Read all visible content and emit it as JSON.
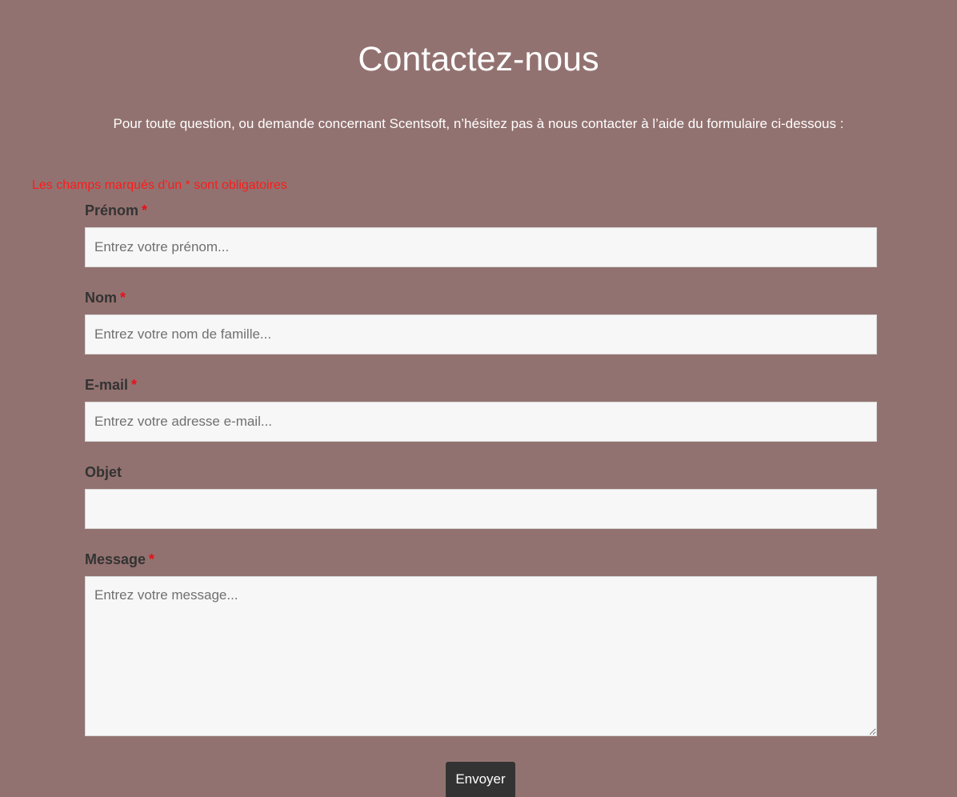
{
  "header": {
    "title": "Contactez-nous",
    "intro": "Pour toute question, ou demande concernant Scentsoft, n’hésitez pas à nous contacter à l’aide du formulaire ci-dessous :"
  },
  "form": {
    "required_note": "Les champs marqués d'un * sont obligatoires",
    "required_marker": "*",
    "fields": {
      "firstname": {
        "label": "Prénom",
        "required": true,
        "value": "",
        "placeholder": "Entrez votre prénom..."
      },
      "lastname": {
        "label": "Nom",
        "required": true,
        "value": "",
        "placeholder": "Entrez votre nom de famille..."
      },
      "email": {
        "label": "E-mail",
        "required": true,
        "value": "",
        "placeholder": "Entrez votre adresse e-mail..."
      },
      "subject": {
        "label": "Objet",
        "required": false,
        "value": "",
        "placeholder": ""
      },
      "message": {
        "label": "Message",
        "required": true,
        "value": "",
        "placeholder": "Entrez votre message..."
      }
    },
    "submit_label": "Envoyer"
  },
  "colors": {
    "background": "#927270",
    "required_text": "#ff1a1a",
    "label_text": "#333333",
    "input_background": "#f7f7f7",
    "button_background": "#333333",
    "button_text": "#ffffff"
  }
}
